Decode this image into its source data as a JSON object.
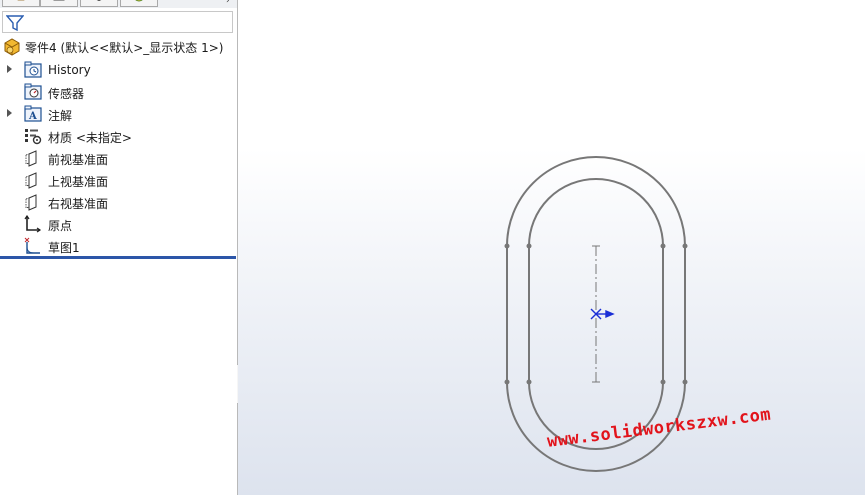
{
  "feature_tree": {
    "root_label": "零件4  (默认<<默认>_显示状态 1>)",
    "items": [
      {
        "label": "History",
        "icon": "history-folder-icon",
        "expandable": true
      },
      {
        "label": "传感器",
        "icon": "sensor-icon",
        "expandable": false
      },
      {
        "label": "注解",
        "icon": "annotations-icon",
        "expandable": true
      },
      {
        "label": "材质 <未指定>",
        "icon": "material-icon",
        "expandable": false
      },
      {
        "label": "前视基准面",
        "icon": "plane-icon",
        "expandable": false
      },
      {
        "label": "上视基准面",
        "icon": "plane-icon",
        "expandable": false
      },
      {
        "label": "右视基准面",
        "icon": "plane-icon",
        "expandable": false
      },
      {
        "label": "原点",
        "icon": "origin-icon",
        "expandable": false
      },
      {
        "label": "草图1",
        "icon": "sketch-icon",
        "expandable": false
      }
    ]
  },
  "panel_tabs": [
    "feature-manager-tab",
    "property-manager-tab",
    "configuration-manager-tab",
    "display-manager-tab"
  ],
  "viewport": {
    "watermark": "www.solidworkszxw.com",
    "sketch": "slot-offset-sketch"
  },
  "colors": {
    "rollback_bar": "#2c56a8",
    "sketch_line": "#777777",
    "watermark": "#e2131b",
    "origin": "#1b2fd6"
  }
}
